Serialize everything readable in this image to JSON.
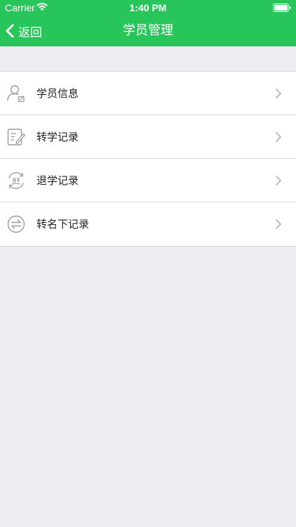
{
  "status_bar": {
    "carrier": "Carrier",
    "time": "1:40 PM"
  },
  "nav_bar": {
    "back_label": "返回",
    "title": "学员管理"
  },
  "list": {
    "items": [
      {
        "label": "学员信息",
        "icon": "student-info-icon"
      },
      {
        "label": "转学记录",
        "icon": "transfer-record-icon"
      },
      {
        "label": "退学记录",
        "icon": "withdraw-record-icon"
      },
      {
        "label": "转名下记录",
        "icon": "ownership-transfer-icon"
      }
    ]
  },
  "colors": {
    "accent": "#28C65A",
    "background": "#EDEDF2",
    "icon": "#9A9A9A"
  }
}
